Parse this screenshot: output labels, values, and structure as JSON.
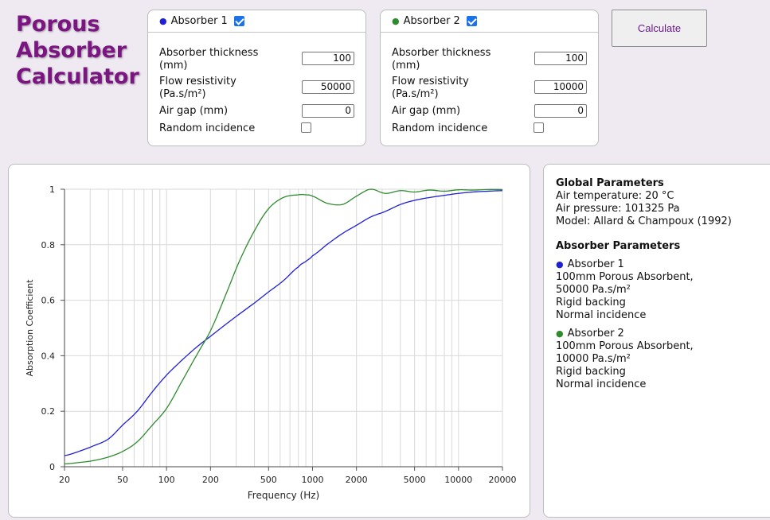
{
  "app": {
    "title_lines": [
      "Porous",
      "Absorber",
      "Calculator"
    ]
  },
  "colors": {
    "title": "#7b1582",
    "absorber1": "#1f1fd6",
    "absorber2": "#2e8b2e",
    "accent": "#1a73e8"
  },
  "absorbers": [
    {
      "title": "Absorber 1",
      "dot_color": "#1f1fd6",
      "enabled": true,
      "thickness_label_1": "Absorber thickness",
      "thickness_label_2": "(mm)",
      "thickness_value": "100",
      "flow_label_1": "Flow resistivity",
      "flow_label_2": "(Pa.s/m²)",
      "flow_value": "50000",
      "airgap_label": "Air gap (mm)",
      "airgap_value": "0",
      "random_label": "Random incidence",
      "random_checked": false
    },
    {
      "title": "Absorber 2",
      "dot_color": "#2e8b2e",
      "enabled": true,
      "thickness_label_1": "Absorber thickness",
      "thickness_label_2": "(mm)",
      "thickness_value": "100",
      "flow_label_1": "Flow resistivity",
      "flow_label_2": "(Pa.s/m²)",
      "flow_value": "10000",
      "airgap_label": "Air gap (mm)",
      "airgap_value": "0",
      "random_label": "Random incidence",
      "random_checked": false
    }
  ],
  "calculate_label": "Calculate",
  "info": {
    "global_heading": "Global Parameters",
    "global_lines": [
      "Air temperature: 20 °C",
      "Air pressure: 101325 Pa",
      "Model: Allard & Champoux (1992)"
    ],
    "absorber_heading": "Absorber Parameters",
    "absorbers": [
      {
        "name": "Absorber 1",
        "dot_color": "#1f1fd6",
        "lines": [
          "100mm Porous Absorbent,",
          "50000 Pa.s/m²",
          "Rigid backing",
          "Normal incidence"
        ]
      },
      {
        "name": "Absorber 2",
        "dot_color": "#2e8b2e",
        "lines": [
          "100mm Porous Absorbent,",
          "10000 Pa.s/m²",
          "Rigid backing",
          "Normal incidence"
        ]
      }
    ]
  },
  "chart_data": {
    "type": "line",
    "title": "",
    "xlabel": "Frequency (Hz)",
    "ylabel": "Absorption Coefficient",
    "x_scale": "log",
    "xlim": [
      20,
      20000
    ],
    "ylim": [
      0,
      1
    ],
    "grid": true,
    "legend": "none",
    "x_ticks": [
      "20",
      "50",
      "100",
      "200",
      "500",
      "1000",
      "2000",
      "5000",
      "10000",
      "20000"
    ],
    "y_ticks": [
      "0",
      "0.2",
      "0.4",
      "0.6",
      "0.8",
      "1"
    ],
    "x": [
      20,
      25,
      31.5,
      40,
      50,
      63,
      80,
      100,
      125,
      160,
      200,
      250,
      315,
      400,
      500,
      630,
      800,
      900,
      1000,
      1250,
      1600,
      2000,
      2500,
      3150,
      4000,
      5000,
      6300,
      8000,
      10000,
      12500,
      16000,
      20000
    ],
    "series": [
      {
        "name": "Absorber 1",
        "color": "#1f1fd6",
        "values": [
          0.04,
          0.055,
          0.075,
          0.1,
          0.15,
          0.2,
          0.27,
          0.33,
          0.38,
          0.43,
          0.47,
          0.51,
          0.55,
          0.59,
          0.63,
          0.67,
          0.72,
          0.74,
          0.76,
          0.8,
          0.84,
          0.87,
          0.9,
          0.92,
          0.945,
          0.96,
          0.97,
          0.978,
          0.985,
          0.99,
          0.993,
          0.995
        ]
      },
      {
        "name": "Absorber 2",
        "color": "#2e8b2e",
        "values": [
          0.01,
          0.015,
          0.022,
          0.035,
          0.055,
          0.09,
          0.15,
          0.21,
          0.3,
          0.4,
          0.49,
          0.61,
          0.74,
          0.85,
          0.93,
          0.97,
          0.98,
          0.98,
          0.975,
          0.95,
          0.945,
          0.975,
          1.0,
          0.985,
          0.995,
          0.99,
          0.997,
          0.993,
          0.998,
          0.997,
          0.999,
          0.999
        ]
      }
    ]
  }
}
